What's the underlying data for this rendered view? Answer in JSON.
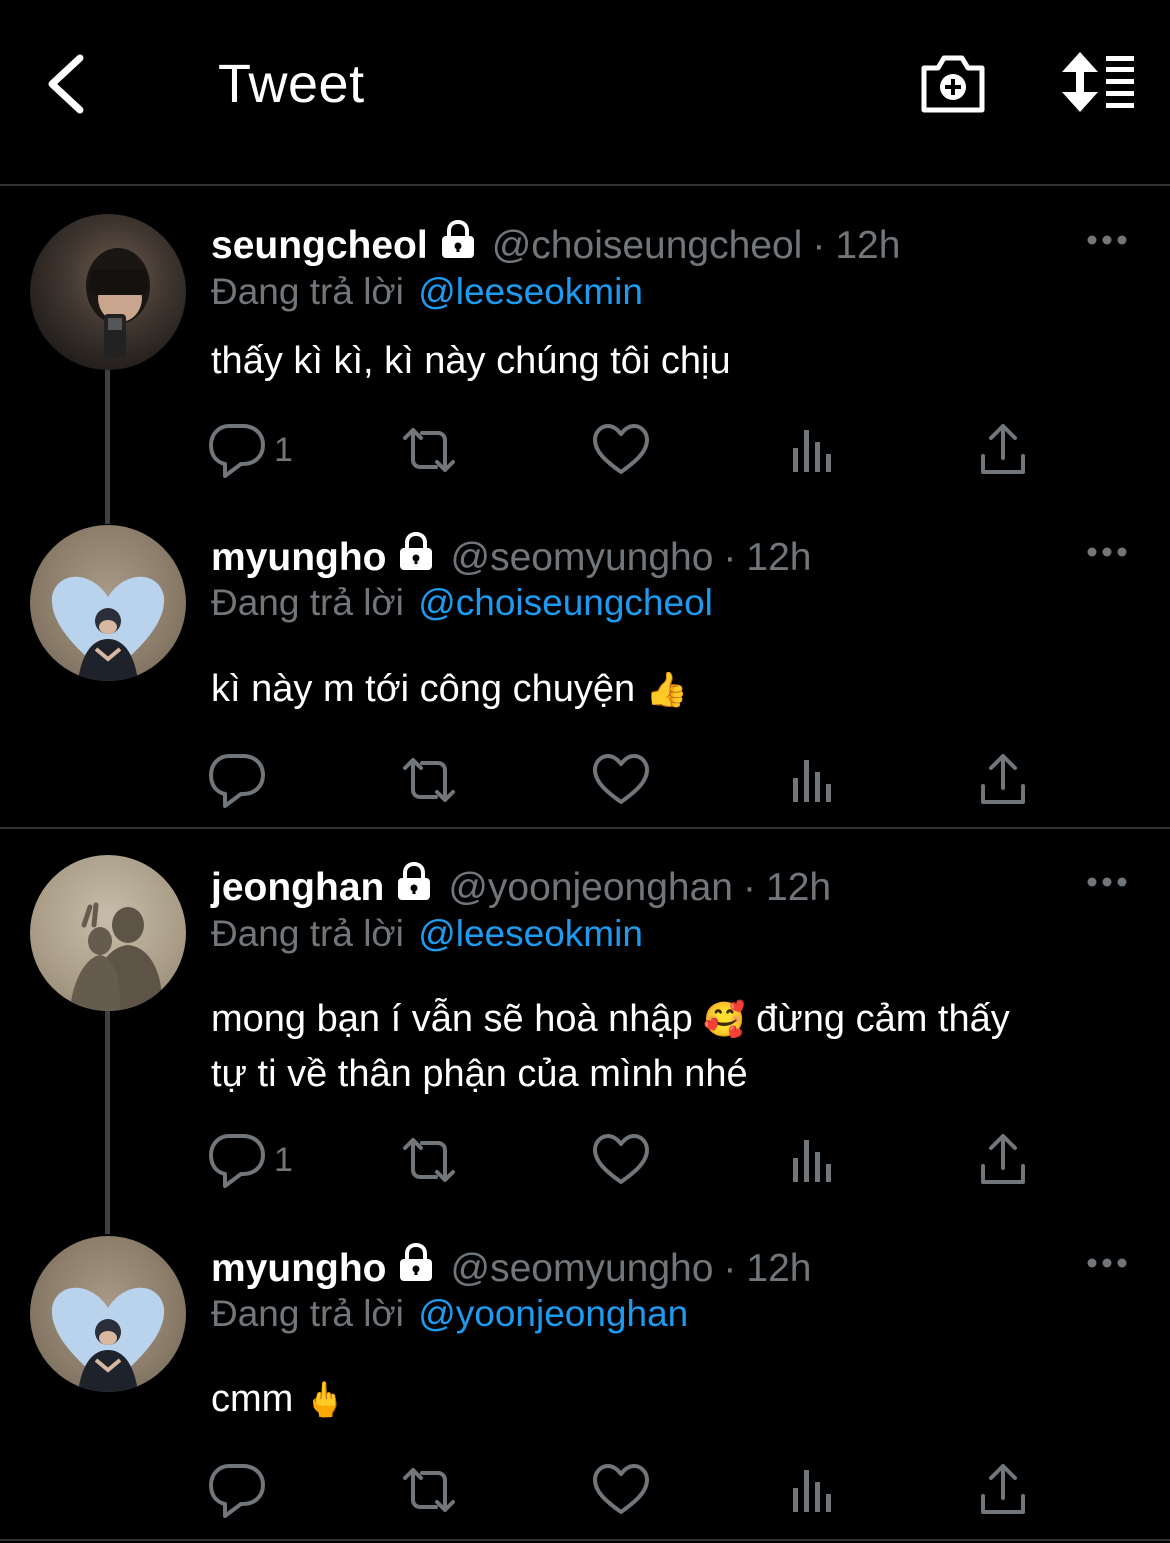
{
  "header": {
    "title": "Tweet"
  },
  "tweets": [
    {
      "name": "seungcheol",
      "handle": "@choiseungcheol",
      "time": "12h",
      "reply_prefix": "Đang trả lời",
      "reply_to": "@leeseokmin",
      "text": "thấy kì kì, kì này chúng tôi chịu",
      "emoji": "",
      "reply_count": "1"
    },
    {
      "name": "myungho",
      "handle": "@seomyungho",
      "time": "12h",
      "reply_prefix": "Đang trả lời",
      "reply_to": "@choiseungcheol",
      "text": "kì này m tới công chuyện",
      "emoji": "👍",
      "reply_count": ""
    },
    {
      "name": "jeonghan",
      "handle": "@yoonjeonghan",
      "time": "12h",
      "reply_prefix": "Đang trả lời",
      "reply_to": "@leeseokmin",
      "text_line1": "mong bạn í vẫn sẽ hoà nhập",
      "emoji": "🥰",
      "text_line1b": "đừng cảm thấy",
      "text_line2": "tự ti về thân phận của mình nhé",
      "reply_count": "1"
    },
    {
      "name": "myungho",
      "handle": "@seomyungho",
      "time": "12h",
      "reply_prefix": "Đang trả lời",
      "reply_to": "@yoonjeonghan",
      "text": "cmm",
      "emoji": "🖕",
      "reply_count": ""
    }
  ],
  "colors": {
    "background": "#000000",
    "text": "#ffffff",
    "muted": "#71767b",
    "link": "#1d9bf0",
    "divider": "#2f3336"
  }
}
